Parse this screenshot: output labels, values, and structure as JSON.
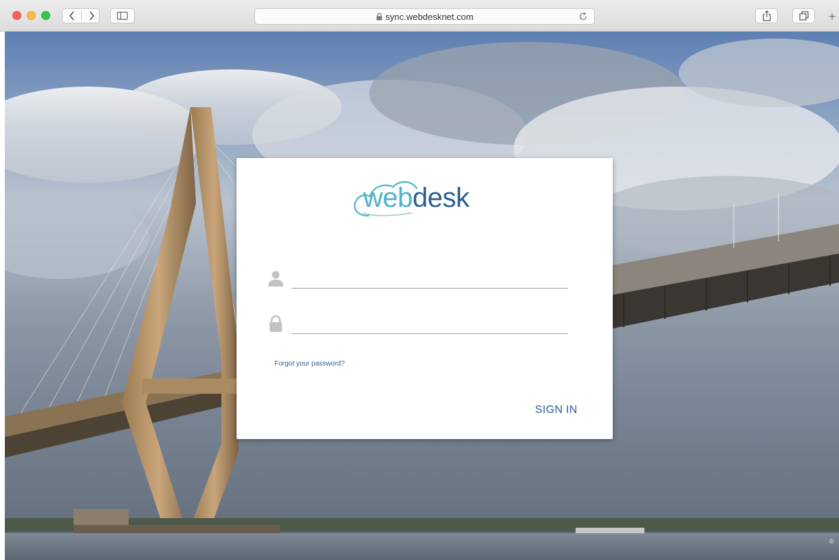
{
  "browser": {
    "url": "sync.webdesknet.com",
    "new_tab_symbol": "+"
  },
  "login": {
    "logo_web": "web",
    "logo_desk": "desk",
    "username_placeholder": "",
    "password_placeholder": "",
    "forgot_label": "Forgot your password?",
    "signin_label": "SIGN IN"
  },
  "footer": {
    "copyright_symbol": "©"
  },
  "colors": {
    "logo_web": "#4fb3c8",
    "logo_desk": "#2e5f8f",
    "link": "#2d5d97"
  }
}
